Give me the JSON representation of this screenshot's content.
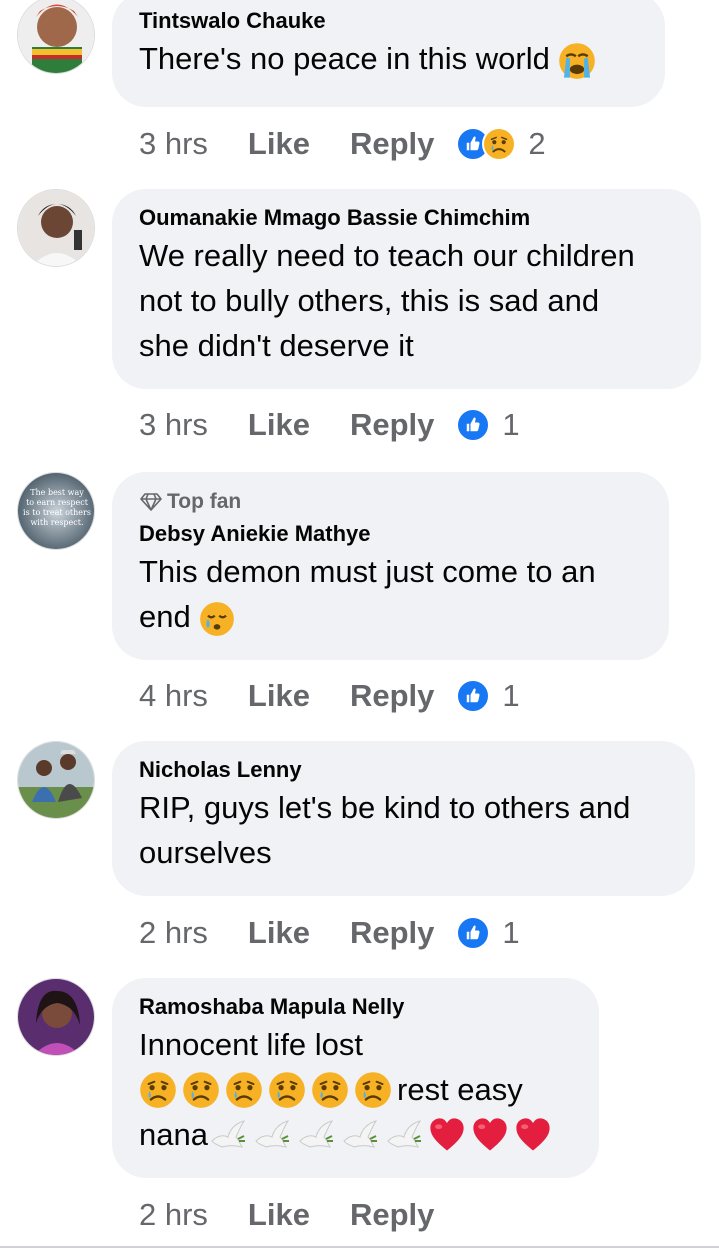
{
  "comments": [
    {
      "author": "Tintswalo Chauke",
      "text": "There's no peace in this world",
      "text_emoji": "crying-face",
      "time": "3 hrs",
      "like": "Like",
      "reply": "Reply",
      "reactions": [
        "like",
        "sad"
      ],
      "reaction_count": "2"
    },
    {
      "author": "Oumanakie Mmago Bassie Chimchim",
      "text_lines": [
        "We really need to teach our children",
        "not to bully others, this is sad and",
        "she didn't deserve it"
      ],
      "time": "3 hrs",
      "like": "Like",
      "reply": "Reply",
      "reactions": [
        "like"
      ],
      "reaction_count": "1"
    },
    {
      "badge": "Top fan",
      "author": "Debsy Aniekie Mathye",
      "text_lines": [
        "This demon must just come to an",
        "end"
      ],
      "text_emoji": "sleepy-face",
      "avatar_text": [
        "The best way",
        "to earn respect",
        "is to treat others",
        "with respect."
      ],
      "time": "4 hrs",
      "like": "Like",
      "reply": "Reply",
      "reactions": [
        "like"
      ],
      "reaction_count": "1"
    },
    {
      "author": "Nicholas Lenny",
      "text_lines": [
        "RIP, guys let's be kind to others and",
        "ourselves"
      ],
      "time": "2 hrs",
      "like": "Like",
      "reply": "Reply",
      "reactions": [
        "like"
      ],
      "reaction_count": "1"
    },
    {
      "author": "Ramoshaba Mapula Nelly",
      "text_line1": "Innocent life lost",
      "text_line2_suffix": "rest easy",
      "text_line3_prefix": "nana",
      "sad_emoji_count": 6,
      "dove_count": 5,
      "heart_count": 3,
      "time": "2 hrs",
      "like": "Like",
      "reply": "Reply"
    }
  ],
  "colors": {
    "bubble": "#f0f2f5",
    "secondary_text": "#65676b",
    "like_blue": "#1877f2",
    "heart_red": "#e41e3f",
    "emoji_yellow": "#f7b125"
  }
}
